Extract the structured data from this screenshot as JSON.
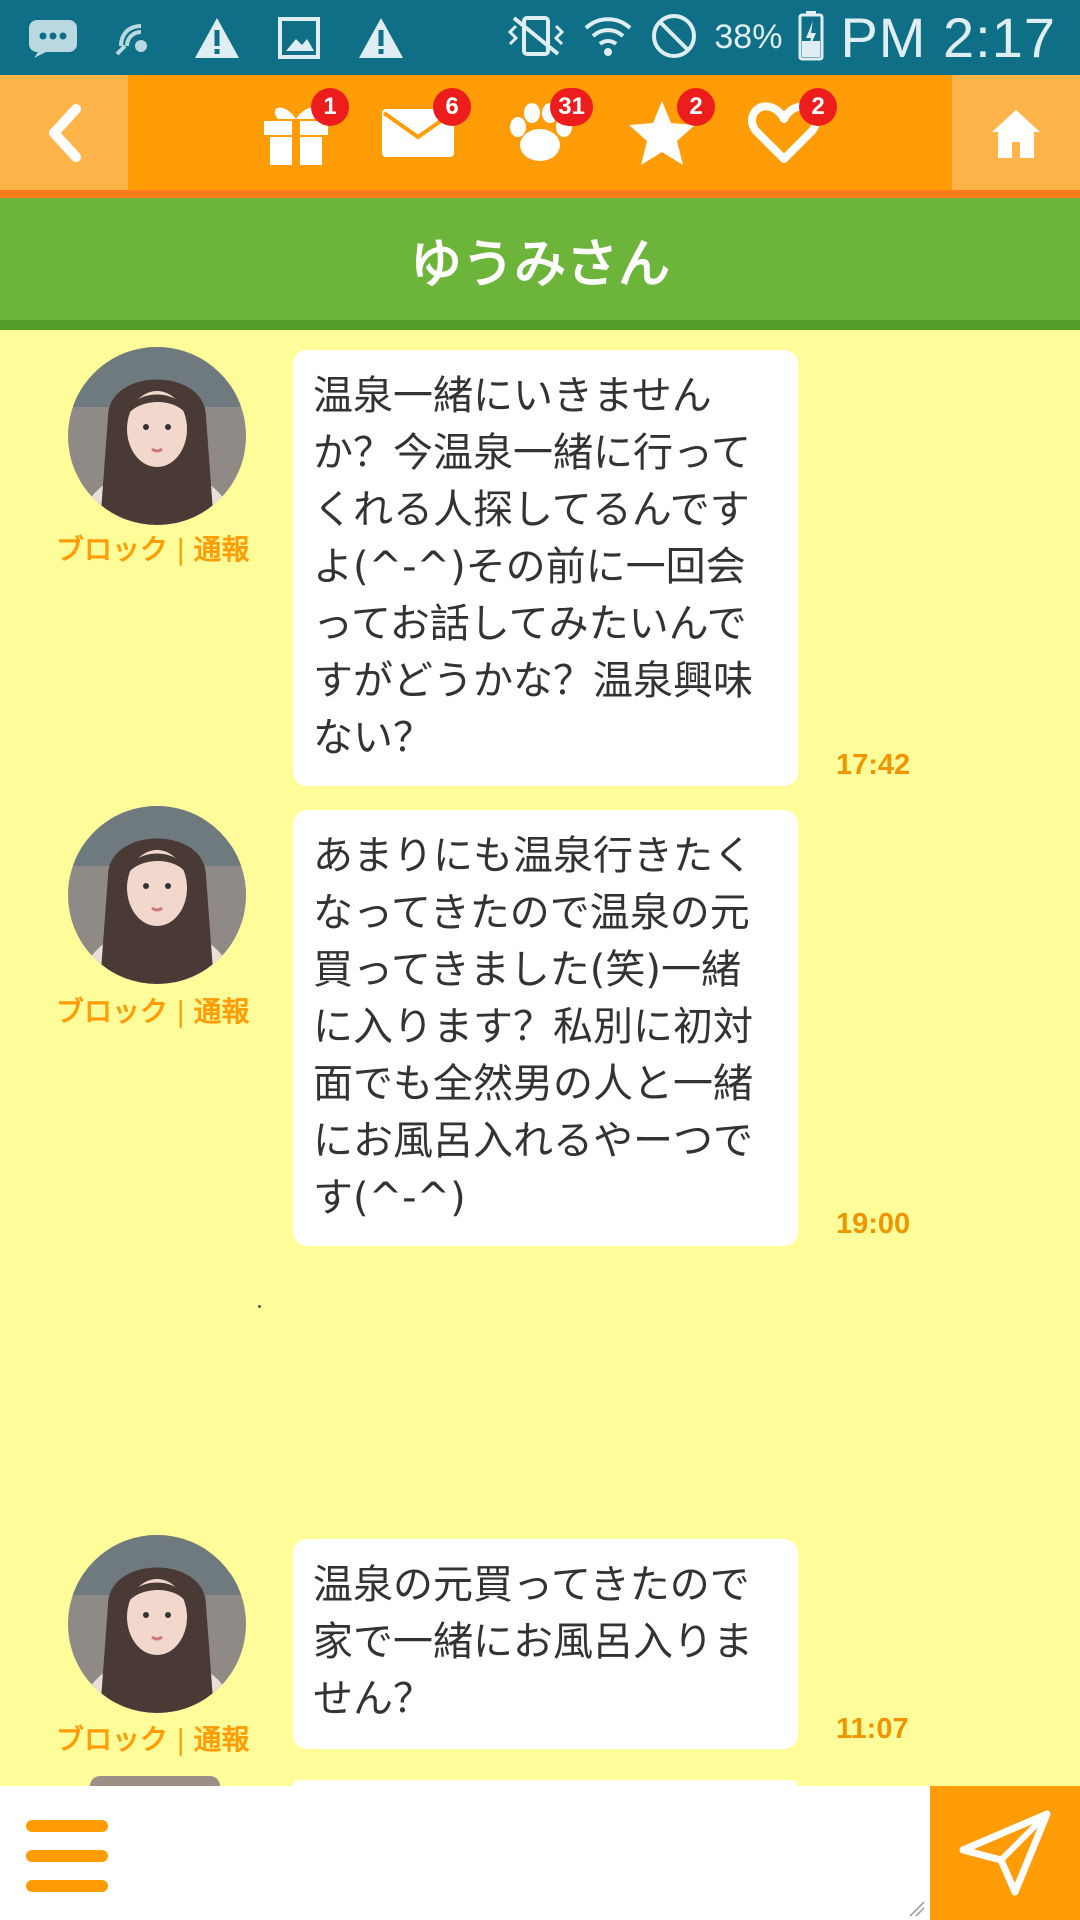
{
  "status_bar": {
    "icons_left": [
      "messages-notification-icon",
      "wifi-calling-icon",
      "warning-icon",
      "image-icon",
      "warning-icon"
    ],
    "icons_right": [
      "vibrate-icon",
      "wifi-icon",
      "do-not-disturb-icon",
      "battery-charging-icon"
    ],
    "battery": "38%",
    "time": "PM 2:17"
  },
  "nav": {
    "items": [
      {
        "name": "gift",
        "icon": "gift-icon",
        "badge": "1"
      },
      {
        "name": "mail",
        "icon": "mail-icon",
        "badge": "6"
      },
      {
        "name": "footprint",
        "icon": "paw-icon",
        "badge": "31"
      },
      {
        "name": "favorite",
        "icon": "star-icon",
        "badge": "2"
      },
      {
        "name": "like",
        "icon": "heart-icon",
        "badge": "2"
      }
    ],
    "back_icon": "chevron-left-icon",
    "home_icon": "home-icon"
  },
  "title": "ゆうみさん",
  "messages": [
    {
      "block_label": "ブロック",
      "separator": "|",
      "report_label": "通報",
      "text": "温泉一緒にいきませんか？今温泉一緒に行ってくれる人探してるんですよ(^-^)その前に一回会ってお話してみたいんですがどうかな？温泉興味ない？",
      "time": "17:42"
    },
    {
      "block_label": "ブロック",
      "separator": "|",
      "report_label": "通報",
      "text": "あまりにも温泉行きたくなってきたので温泉の元買ってきました(笑)一緒に入ります？私別に初対面でも全然男の人と一緒にお風呂入れるやーつです(^-^)",
      "time": "19:00"
    },
    {
      "block_label": "ブロック",
      "separator": "|",
      "report_label": "通報",
      "text": "温泉の元買ってきたので家で一緒にお風呂入りません？",
      "time": "11:07"
    }
  ],
  "input": {
    "placeholder": "",
    "value": ""
  },
  "colors": {
    "status_bar": "#0f6f86",
    "nav_orange": "#ff9c06",
    "nav_light_orange": "#ffb44a",
    "title_green": "#6cb53a",
    "chat_background": "#fffd9a",
    "badge_red": "#ee1d1d",
    "accent_text": "#ff9c06"
  }
}
